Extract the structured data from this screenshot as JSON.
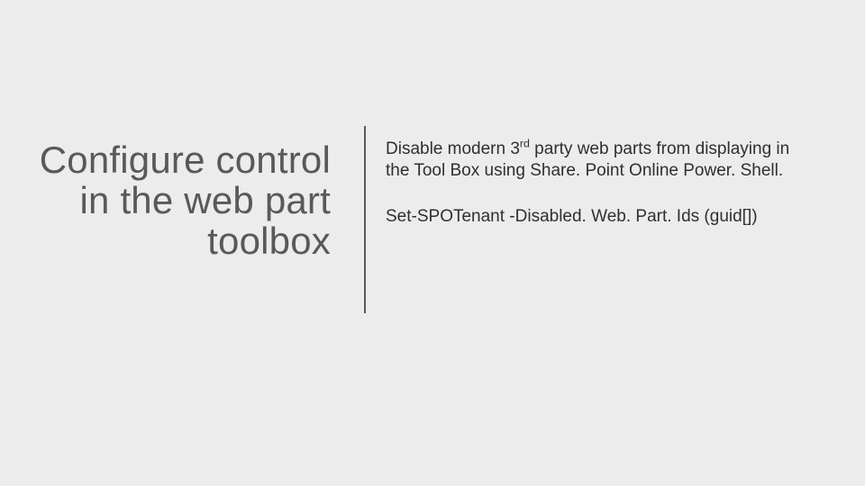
{
  "slide": {
    "title": "Configure control in the web part toolbox",
    "body": {
      "paragraph_prefix": "Disable modern 3",
      "paragraph_super": "rd",
      "paragraph_suffix": " party web parts from displaying in the  Tool Box using Share. Point Online Power. Shell.",
      "command": "Set-SPOTenant -Disabled. Web. Part. Ids (guid[])"
    }
  }
}
